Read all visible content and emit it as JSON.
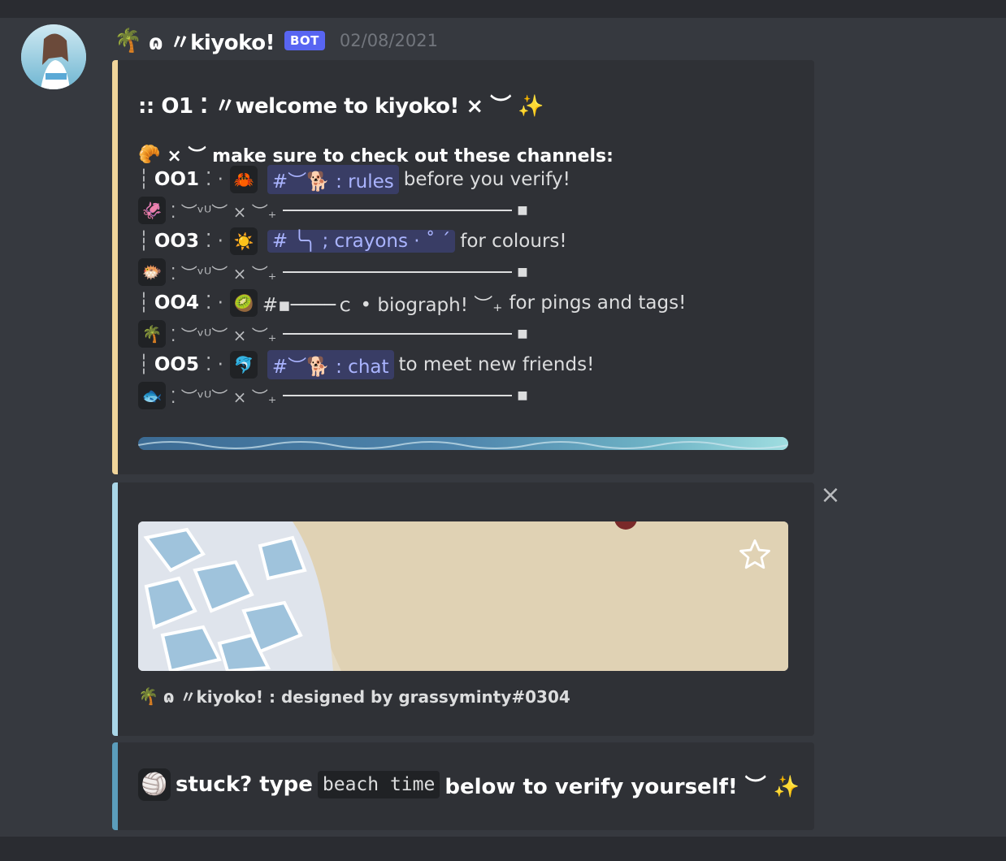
{
  "colors": {
    "bar1": "#f0d49a",
    "bar2": "#a9d6e8",
    "bar3": "#5b9dbb",
    "accent": "#5865f2"
  },
  "message": {
    "author_emoji": "🌴",
    "author_name": "ɷ 〃kiyoko!",
    "bot_badge": "BOT",
    "timestamp": "02/08/2021"
  },
  "embed1": {
    "title": ":: O1 ⁚ 〃welcome to kiyoko! × ︶ ✨",
    "subtitle_emoji": "🥐",
    "subtitle": "× ︶ make sure to check out these channels:",
    "rows": [
      {
        "num": "OO1",
        "sep": "⁚ ·",
        "emoji": "🦀",
        "channel": "#︶🐕 : rules",
        "text": "before you verify!"
      },
      {
        "sep_emoji": "🦑",
        "sep_text": "⁚ ︶ᵛᵁ︶ × ︶₊"
      },
      {
        "num": "OO3",
        "sep": "⁚ ·",
        "emoji": "☀️",
        "channel": "# ╰╮ ; crayons · ˚ ˊ",
        "text": "for colours!"
      },
      {
        "sep_emoji": "🐡",
        "sep_text": "⁚ ︶ᵛᵁ︶ × ︶₊"
      },
      {
        "num": "OO4",
        "sep": "⁚ ·",
        "emoji": "🥝",
        "channel_plain": "#▪────ｃ • biograph! ︶₊",
        "text": "for pings and tags!"
      },
      {
        "sep_emoji": "🌴",
        "sep_text": "⁚ ︶ᵛᵁ︶ × ︶₊"
      },
      {
        "num": "OO5",
        "sep": "⁚ ·",
        "emoji": "🐬",
        "channel": "#︶🐕 : chat",
        "text": "to meet new friends!"
      },
      {
        "sep_emoji": "🐟",
        "sep_text": "⁚ ︶ᵛᵁ︶ × ︶₊"
      }
    ]
  },
  "embed2": {
    "close_icon": "×",
    "footer_emoji": "🌴",
    "footer": "ɷ 〃kiyoko! : designed by grassyminty#0304"
  },
  "embed3": {
    "emoji": "🏐",
    "before": "stuck? type",
    "code": "beach time",
    "after": "below to verify yourself! ︶ ✨"
  }
}
